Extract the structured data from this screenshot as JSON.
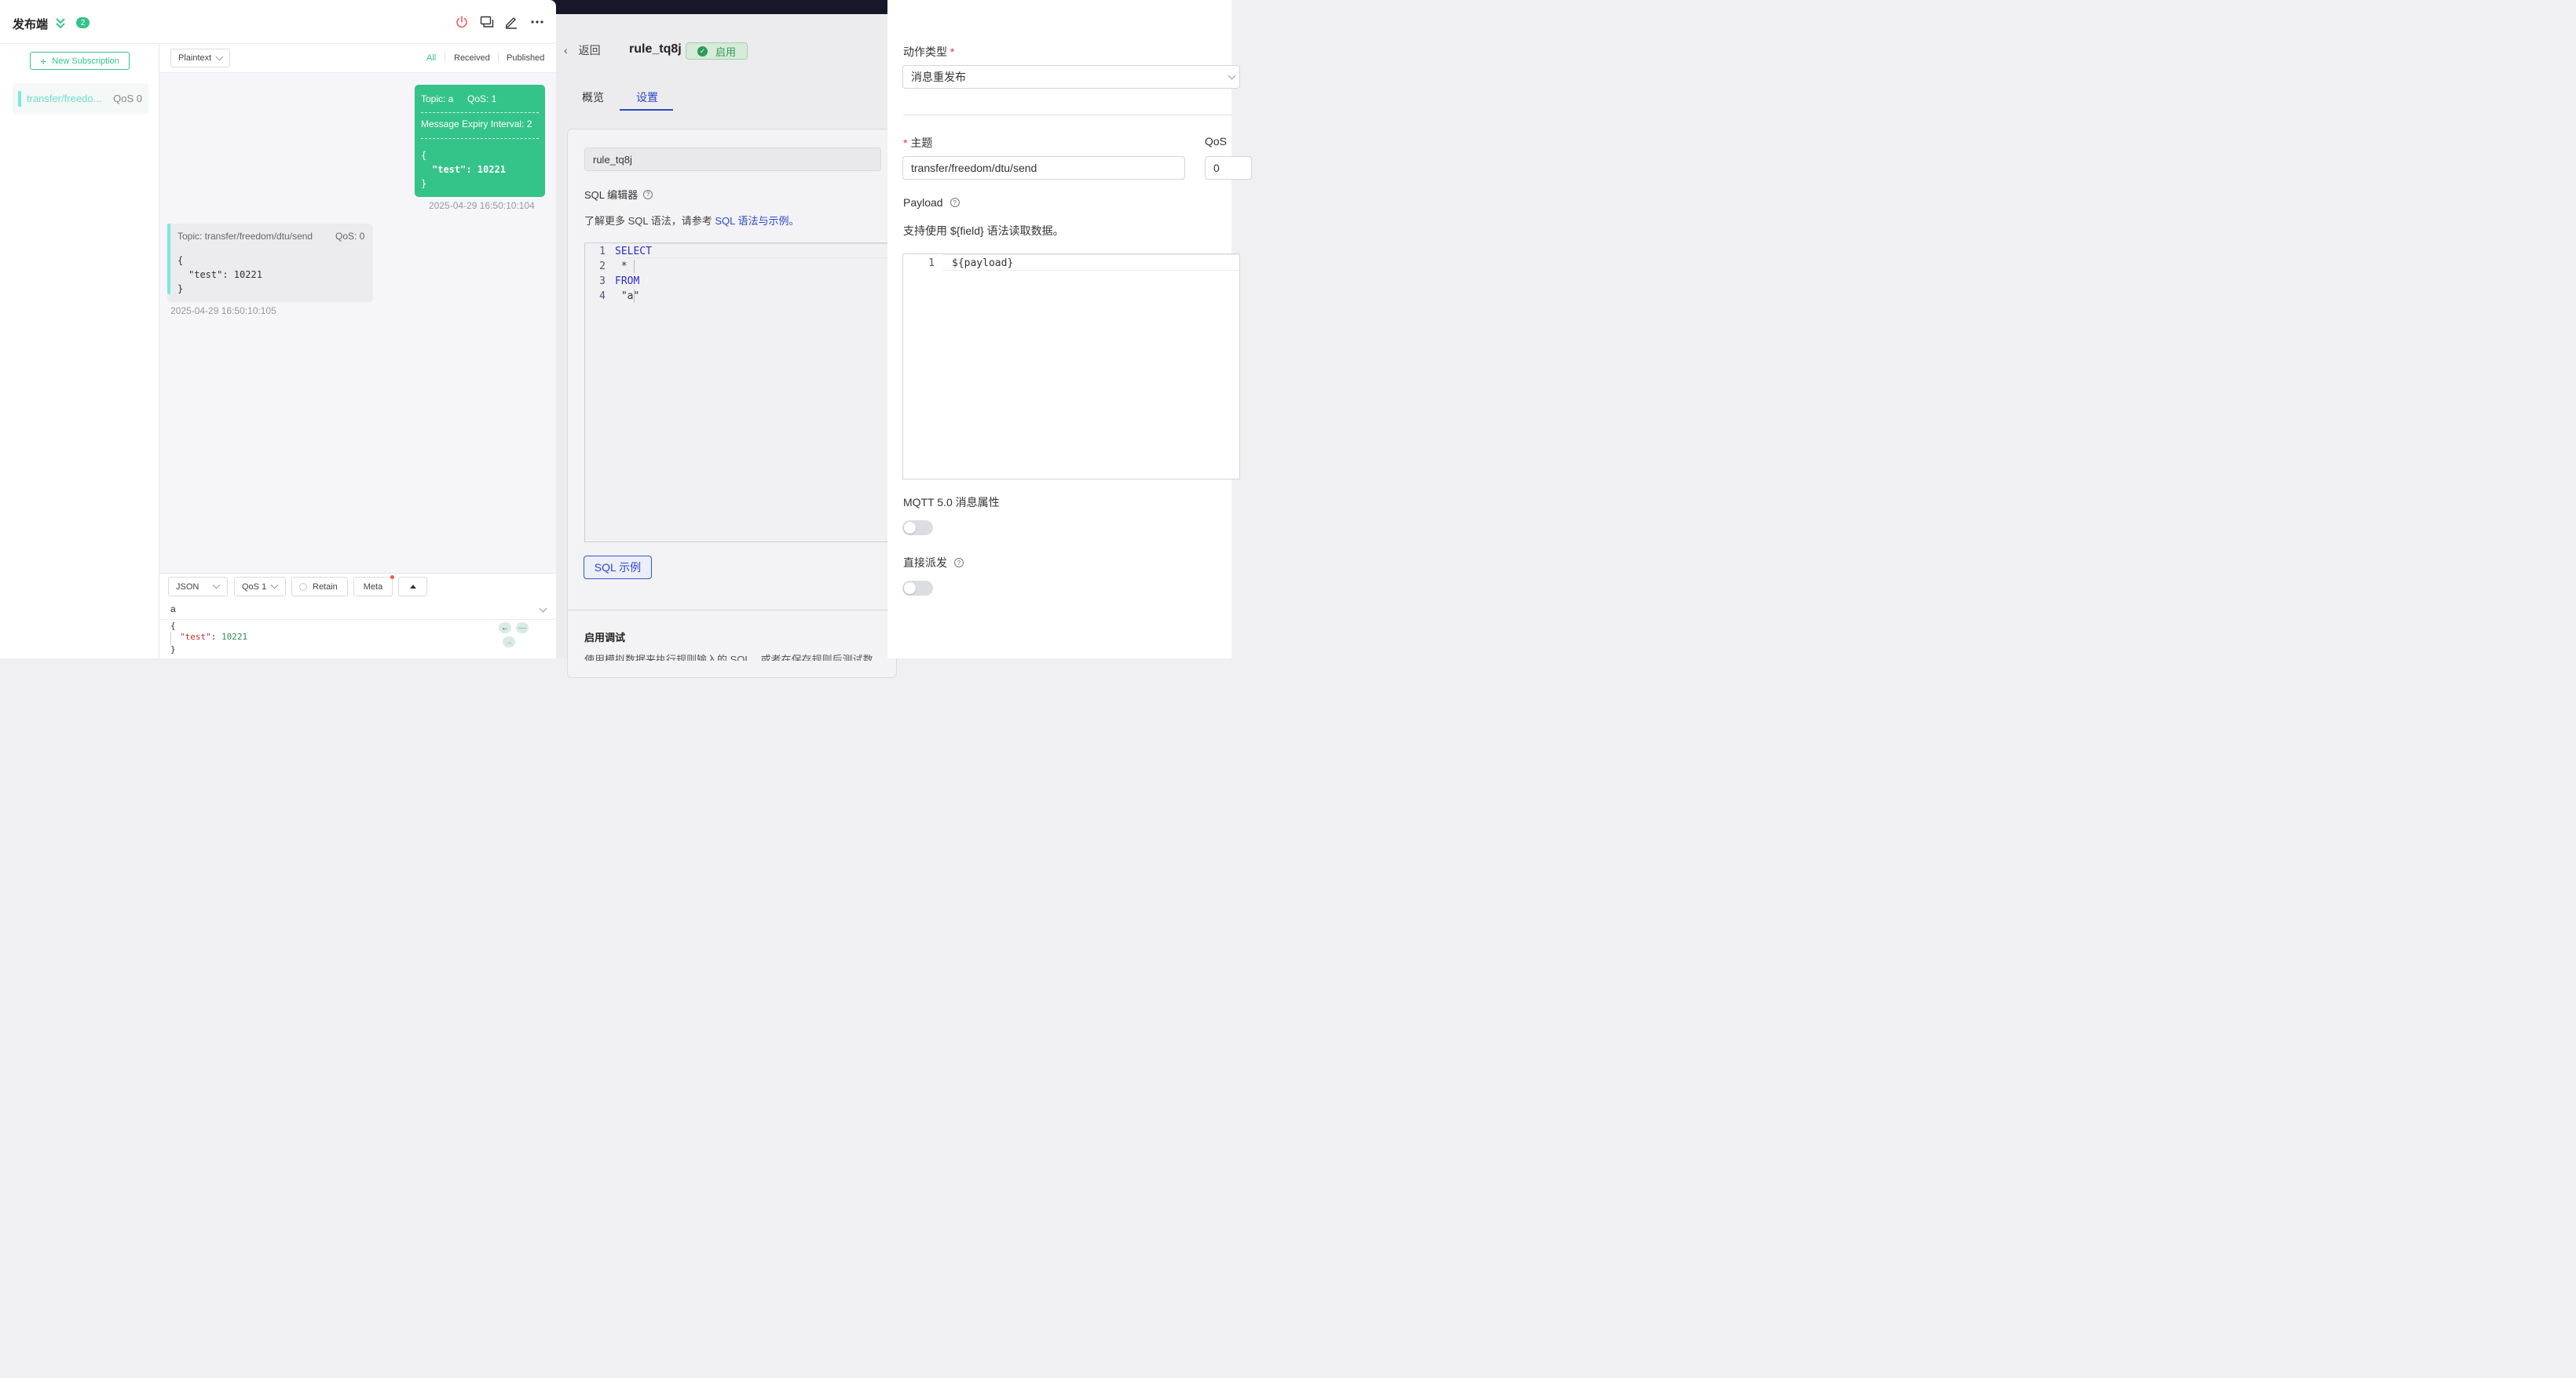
{
  "mqttx": {
    "title": "发布端",
    "badge": "2",
    "new_subscription_label": "New Subscription",
    "subscription": {
      "topic": "transfer/freedo...",
      "qos": "QoS 0"
    },
    "format_select": "Plaintext",
    "filters": [
      "All",
      "Received",
      "Published"
    ],
    "message_out": {
      "topic": "Topic: a",
      "qos": "QoS: 1",
      "expiry": "Message Expiry Interval: 2",
      "payload_open": "{",
      "payload_key": "\"test\": 10221",
      "payload_close": "}",
      "time": "2025-04-29 16:50:10:104"
    },
    "message_in": {
      "topic": "Topic: transfer/freedom/dtu/send",
      "qos": "QoS: 0",
      "payload_open": "{",
      "payload_key": "\"test\": 10221",
      "payload_close": "}",
      "time": "2025-04-29 16:50:10:105"
    },
    "publish": {
      "format": "JSON",
      "qos": "QoS 1",
      "retain": "Retain",
      "meta": "Meta",
      "topic": "a",
      "payload_open": "{",
      "payload_key": "\"test\"",
      "payload_colon": ": ",
      "payload_value": "10221",
      "payload_close": "}"
    }
  },
  "background": {
    "back_label": "返回",
    "rule_name": "rule_tq8j",
    "status": "启用",
    "tabs": [
      "概览",
      "设置"
    ],
    "name_value": "rule_tq8j",
    "sql_editor_label": "SQL 编辑器",
    "sql_hint_prefix": "了解更多 SQL 语法，请参考",
    "sql_hint_link": "SQL 语法与示例。",
    "sql_lines": [
      {
        "no": "1",
        "text": "SELECT",
        "kw": true
      },
      {
        "no": "2",
        "text": " *",
        "kw": false
      },
      {
        "no": "3",
        "text": "FROM",
        "kw": true
      },
      {
        "no": "4",
        "text": " \"a\"",
        "kw": false
      }
    ],
    "sql_example_button": "SQL 示例",
    "debug_title": "启用调试",
    "debug_desc": "使用模拟数据来执行规则输入的 SQL，或者在保存规则后测试数"
  },
  "drawer": {
    "action_type_label": "动作类型",
    "action_type_value": "消息重发布",
    "topic_label": "主题",
    "topic_value": "transfer/freedom/dtu/send",
    "qos_label": "QoS",
    "qos_value": "0",
    "payload_label": "Payload",
    "payload_hint": "支持使用 ${field} 语法读取数据。",
    "payload_line_no": "1",
    "payload_code": "${payload}",
    "mqtt_props_label": "MQTT 5.0 消息属性",
    "direct_dispatch_label": "直接派发"
  },
  "colors": {
    "accent_green": "#34c388",
    "link_blue": "#2a48c8",
    "teal": "#7de8dc"
  }
}
